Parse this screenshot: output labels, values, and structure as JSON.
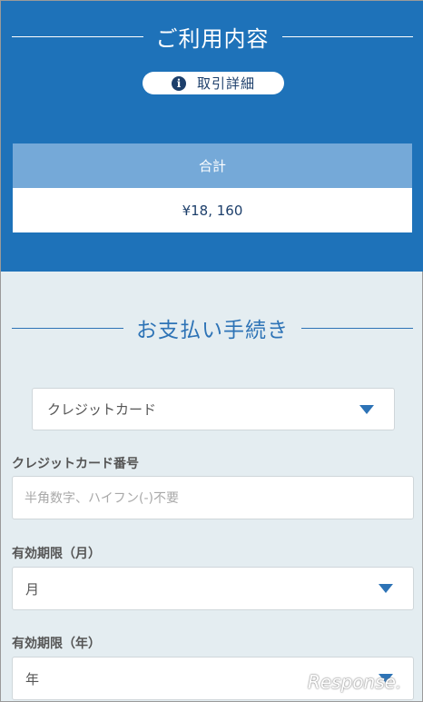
{
  "usage": {
    "title": "ご利用内容",
    "details_button": "取引詳細",
    "total_label": "合計",
    "total_value": "¥18, 160"
  },
  "payment": {
    "title": "お支払い手続き",
    "method_select": "クレジットカード",
    "card_number_label": "クレジットカード番号",
    "card_number_placeholder": "半角数字、ハイフン(-)不要",
    "expiry_month_label": "有効期限（月）",
    "expiry_month_value": "月",
    "expiry_year_label": "有効期限（年）",
    "expiry_year_value": "年"
  },
  "watermark": "Response.",
  "colors": {
    "header_bg": "#1e72b9",
    "accent": "#2d73b6",
    "total_head_bg": "#75a9d8",
    "page_bg": "#e4edf1"
  },
  "icons": {
    "details": "info-icon",
    "dropdown": "triangle-down-icon"
  }
}
